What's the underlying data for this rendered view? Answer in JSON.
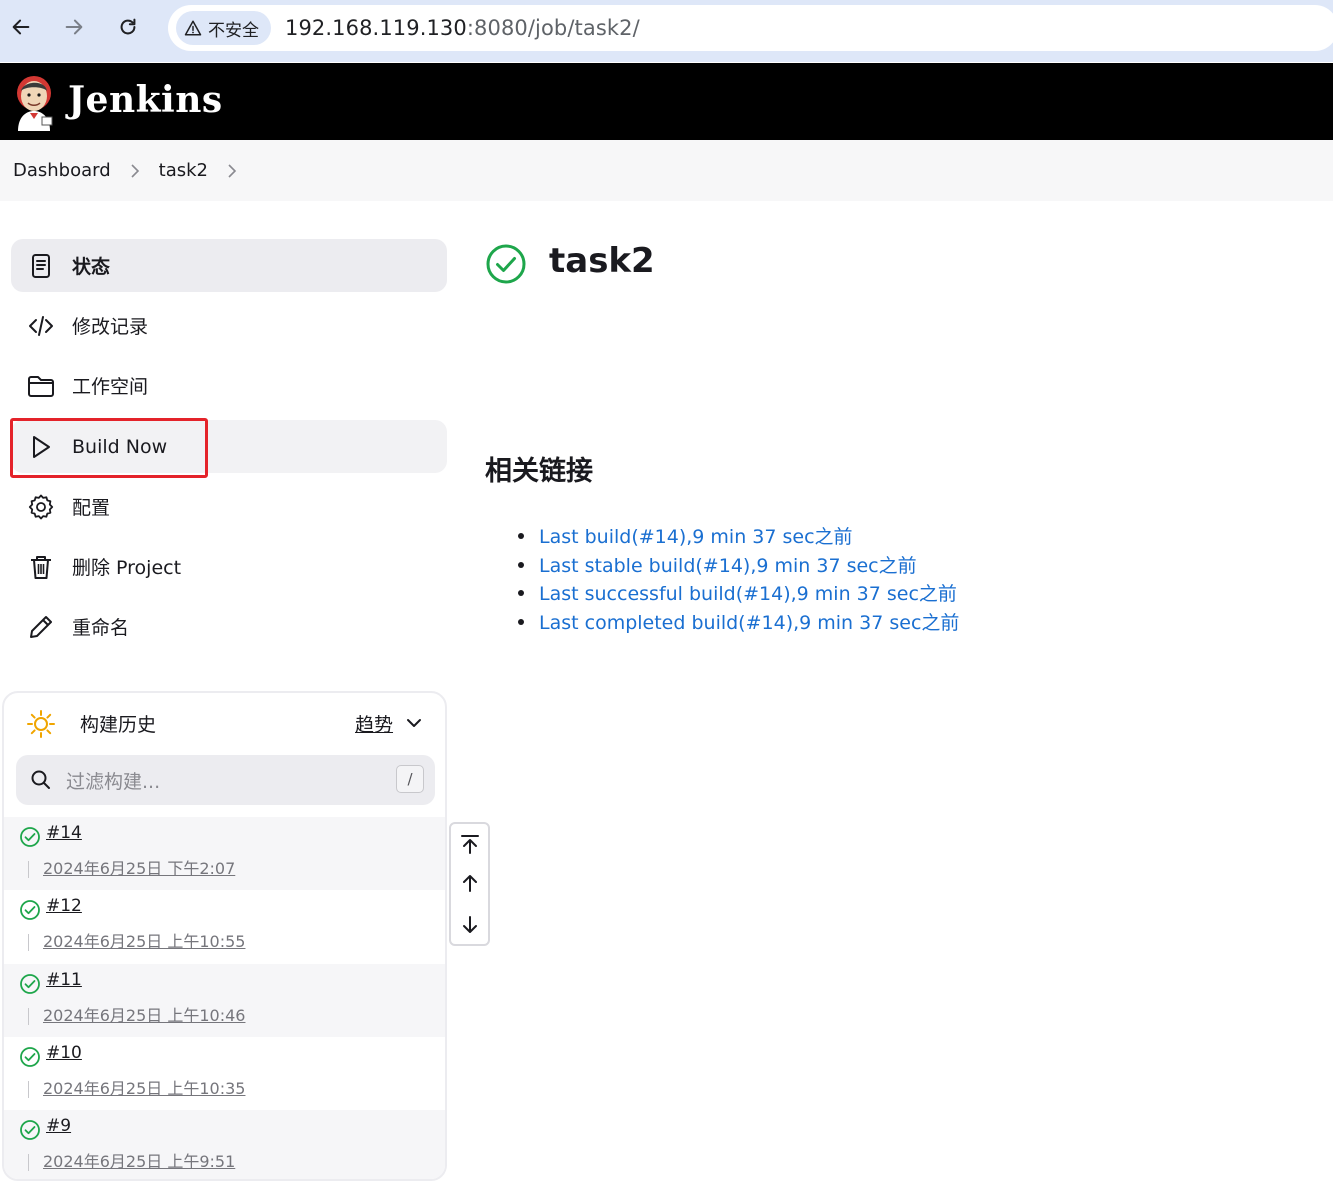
{
  "browser": {
    "security_label": "不安全",
    "url_host": "192.168.119.130",
    "url_rest": ":8080/job/task2/"
  },
  "header": {
    "title": "Jenkins"
  },
  "breadcrumb": {
    "items": [
      "Dashboard",
      "task2"
    ]
  },
  "sidebar": {
    "items": [
      {
        "label": "状态",
        "icon": "document-icon"
      },
      {
        "label": "修改记录",
        "icon": "code-icon"
      },
      {
        "label": "工作空间",
        "icon": "folder-icon"
      },
      {
        "label": "Build Now",
        "icon": "play-icon"
      },
      {
        "label": "配置",
        "icon": "gear-icon"
      },
      {
        "label": "删除 Project",
        "icon": "trash-icon"
      },
      {
        "label": "重命名",
        "icon": "pencil-icon"
      }
    ]
  },
  "build_history": {
    "title": "构建历史",
    "trend_label": "趋势",
    "filter_placeholder": "过滤构建...",
    "shortcut_key": "/",
    "builds": [
      {
        "number": "#14",
        "date": "2024年6月25日 下午2:07",
        "status": "success"
      },
      {
        "number": "#12",
        "date": "2024年6月25日 上午10:55",
        "status": "success"
      },
      {
        "number": "#11",
        "date": "2024年6月25日 上午10:46",
        "status": "success"
      },
      {
        "number": "#10",
        "date": "2024年6月25日 上午10:35",
        "status": "success"
      },
      {
        "number": "#9",
        "date": "2024年6月25日 上午9:51",
        "status": "success"
      }
    ]
  },
  "job": {
    "name": "task2",
    "status": "success"
  },
  "related": {
    "title": "相关链接",
    "links": [
      "Last build(#14),9 min 37 sec之前",
      "Last stable build(#14),9 min 37 sec之前",
      "Last successful build(#14),9 min 37 sec之前",
      "Last completed build(#14),9 min 37 sec之前"
    ]
  },
  "colors": {
    "success": "#1ea64b",
    "link": "#1a6fd1",
    "highlight": "#e4232a",
    "header_bg": "#000000"
  }
}
